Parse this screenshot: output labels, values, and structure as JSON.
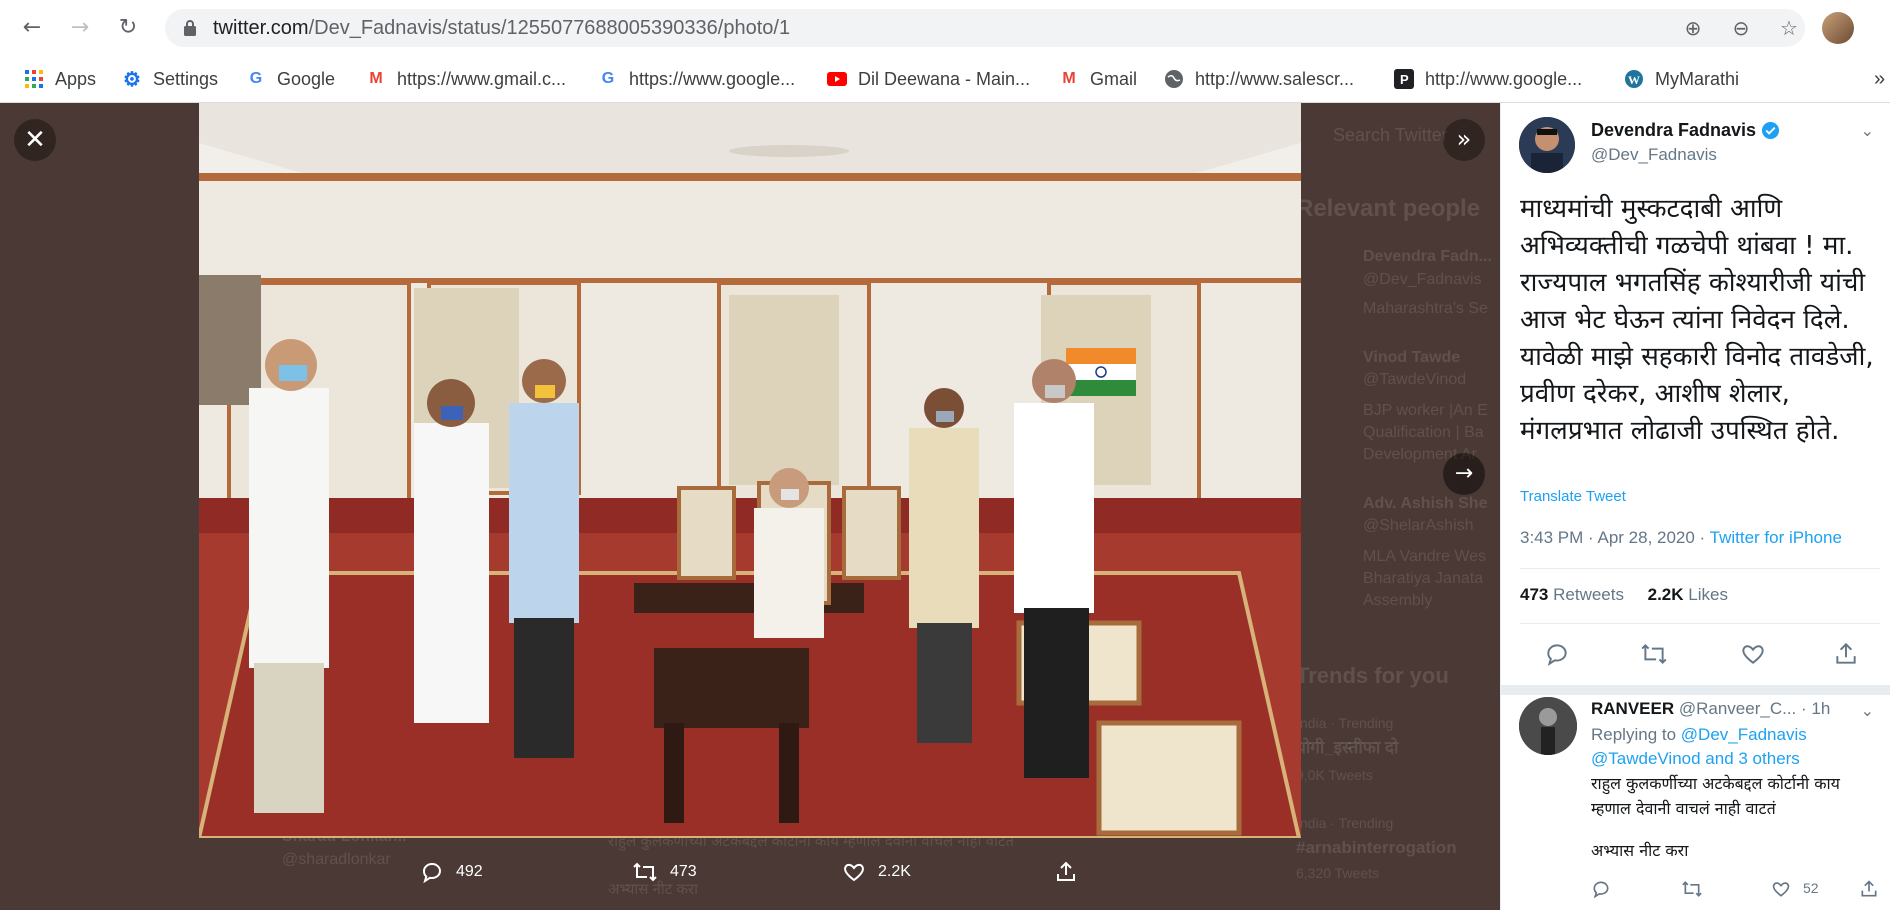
{
  "browser": {
    "url_domain": "twitter.com",
    "url_path": "/Dev_Fadnavis/status/1255077688005390336/photo/1",
    "bookmarks": [
      {
        "label": "Apps",
        "icon": "apps-grid-icon"
      },
      {
        "label": "Settings",
        "icon": "gear-icon"
      },
      {
        "label": "Google",
        "icon": "google-icon"
      },
      {
        "label": "https://www.gmail.c...",
        "icon": "gmail-icon"
      },
      {
        "label": "https://www.google...",
        "icon": "google-icon"
      },
      {
        "label": "Dil Deewana - Main...",
        "icon": "youtube-icon"
      },
      {
        "label": "Gmail",
        "icon": "gmail-icon"
      },
      {
        "label": "http://www.salescr...",
        "icon": "globe-icon"
      },
      {
        "label": "http://www.google...",
        "icon": "p-icon"
      },
      {
        "label": "MyMarathi",
        "icon": "wordpress-icon"
      }
    ],
    "more": "»"
  },
  "viewer": {
    "photo_stats": {
      "replies": "492",
      "retweets": "473",
      "likes": "2.2K"
    },
    "background_text": {
      "search": "Search Twitter",
      "relevant_people": "Relevant people",
      "person1_name": "Devendra Fadn...",
      "person1_handle": "@Dev_Fadnavis",
      "person1_bio": "Maharashtra's Se",
      "person2_name": "Vinod Tawde",
      "person2_handle": "@TawdeVinod",
      "person2_bio": "BJP worker |An E Qualification | Ba Development Ar",
      "person3_name": "Adv. Ashish She",
      "person3_handle": "@ShelarAshish",
      "person3_bio": "MLA Vandre Wes Bharatiya Janata Assembly",
      "trends": "Trends for you",
      "trend_cat1": "India · Trending",
      "trend1": "योगी_इस्तीफा दो",
      "trend1_count": "9,0K Tweets",
      "trend_cat2": "India · Trending",
      "trend2": "#arnabinterrogation",
      "trend2_count": "6,320 Tweets",
      "bottom_name": "Sharad Lonkar...",
      "bottom_handle": "@sharadlonkar",
      "bottom_text": "राहुल कुलकर्णीच्या अटकेबद्दल कोर्टानी काय म्हणाल देवानी वाचलं नाही वाटतं",
      "bottom_text2": "अभ्यास नीट करा"
    }
  },
  "tweet": {
    "name": "Devendra Fadnavis",
    "handle": "@Dev_Fadnavis",
    "body": "माध्यमांची मुस्कटदाबी आणि अभिव्यक्तीची गळचेपी थांबवा ! मा. राज्यपाल भगतसिंह कोश्यारीजी यांची आज भेट घेऊन त्यांना निवेदन दिले. यावेळी माझे सहकारी विनोद तावडेजी, प्रवीण दरेकर, आशीष शेलार, मंगलप्रभात लोढाजी उपस्थित होते.",
    "translate": "Translate Tweet",
    "time": "3:43 PM · Apr 28, 2020 · ",
    "source": "Twitter for iPhone",
    "retweets": "473",
    "retweets_label": "Retweets",
    "likes": "2.2K",
    "likes_label": "Likes"
  },
  "reply": {
    "name": "RANVEER",
    "handle": "@Ranveer_C...",
    "age": "· 1h",
    "replying_to": "Replying to",
    "mention1": "@Dev_Fadnavis",
    "mention2": "@TawdeVinod and 3 others",
    "text": "राहुल कुलकर्णीच्या अटकेबद्दल कोर्टानी काय म्हणाल देवानी वाचलं नाही वाटतं",
    "text2": "अभ्यास नीट करा",
    "likes": "52"
  },
  "colors": {
    "accent": "#1da1f2",
    "overlay": "#4a3934",
    "text": "#14171a",
    "muted": "#657786"
  }
}
